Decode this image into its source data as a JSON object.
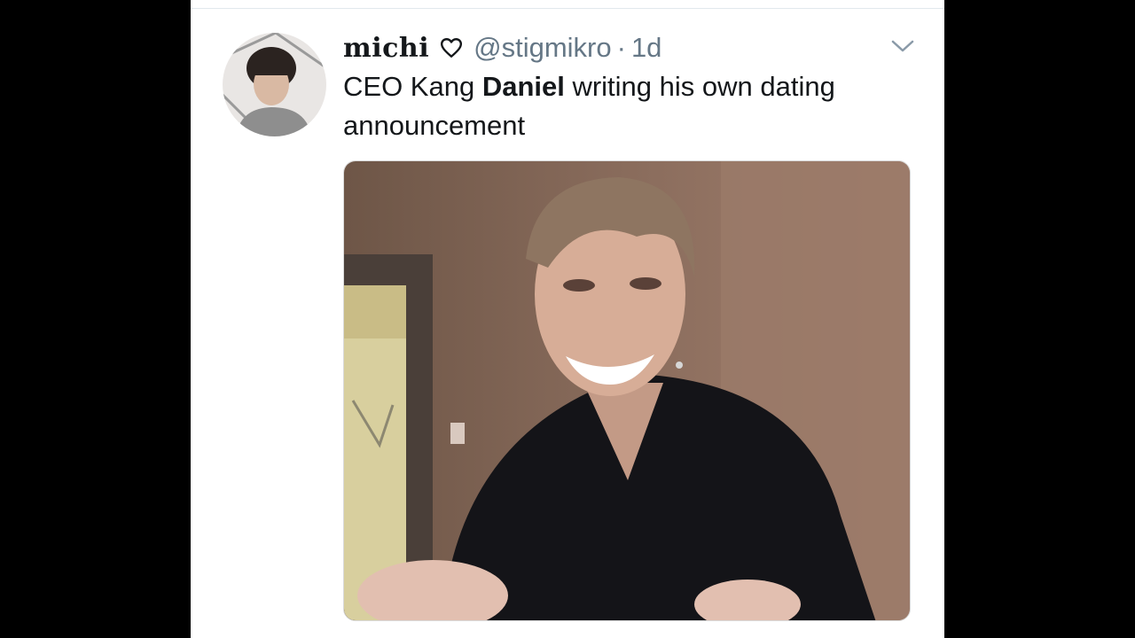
{
  "tweet": {
    "display_name": "michi",
    "heart_icon": "heart-outline-icon",
    "handle": "@stigmikro",
    "separator": "·",
    "timestamp": "1d",
    "menu_icon": "chevron-down-icon",
    "text_before": "CEO Kang ",
    "text_bold": "Daniel",
    "text_after": " writing his own dating announcement",
    "avatar_icon": "profile-avatar",
    "media_icon": "video-thumbnail"
  },
  "colors": {
    "background": "#000000",
    "card": "#ffffff",
    "text": "#14171a",
    "secondary_text": "#657786"
  }
}
